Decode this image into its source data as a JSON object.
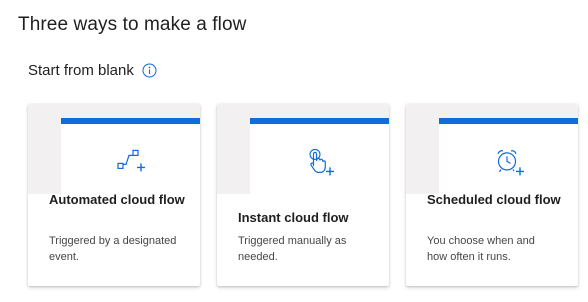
{
  "page": {
    "title": "Three ways to make a flow"
  },
  "section": {
    "title": "Start from blank",
    "info_icon": "info-icon"
  },
  "colors": {
    "accent": "#0f6cdb",
    "art_bg": "#f3f0f1"
  },
  "cards": [
    {
      "title": "Automated cloud flow",
      "description": "Triggered by a designated event.",
      "icon": "automated-flow-icon"
    },
    {
      "title": "Instant cloud flow",
      "description": "Triggered manually as needed.",
      "icon": "instant-flow-icon"
    },
    {
      "title": "Scheduled cloud flow",
      "description": "You choose when and how often it runs.",
      "icon": "scheduled-flow-icon"
    }
  ]
}
